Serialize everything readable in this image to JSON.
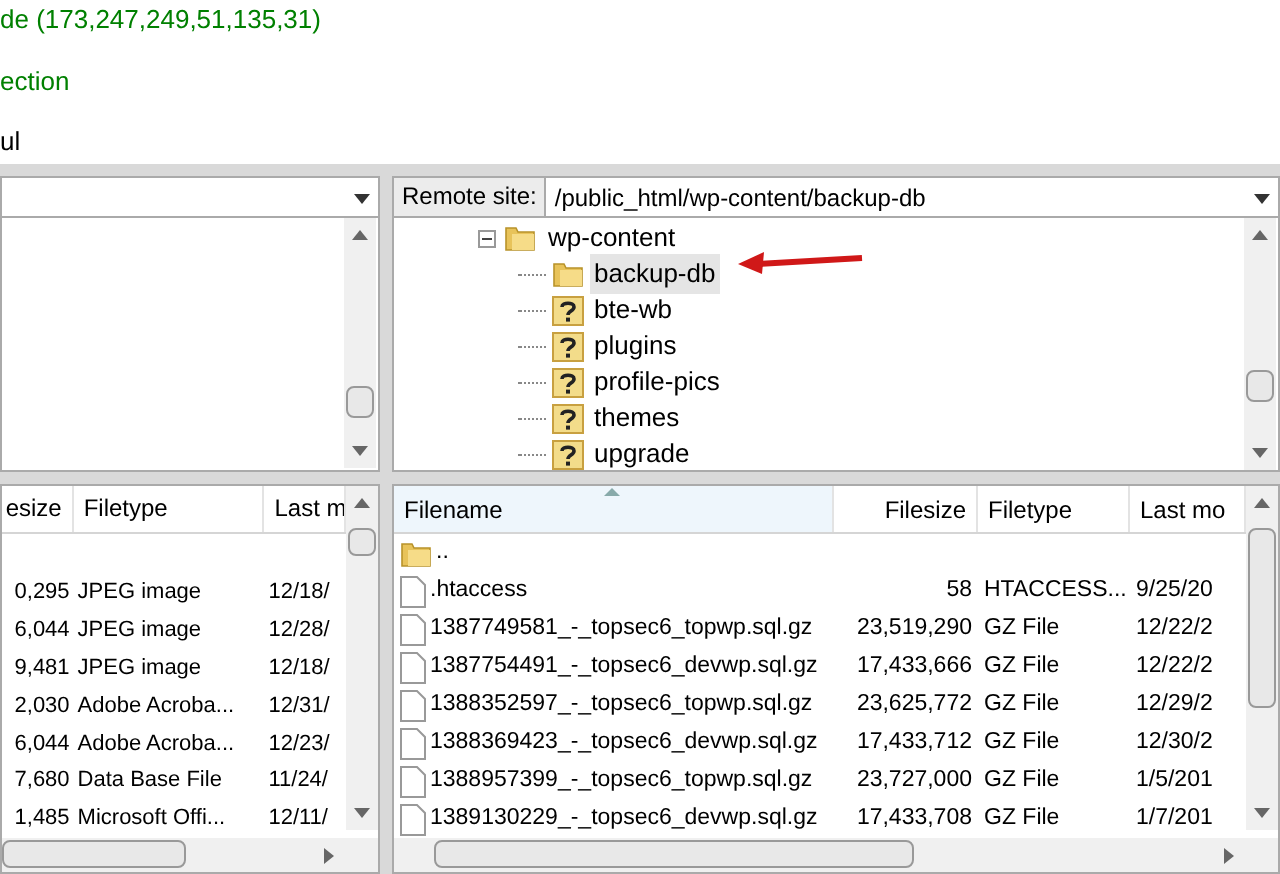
{
  "log": [
    {
      "text": "de (173,247,249,51,135,31)",
      "kind": "status"
    },
    {
      "text": "ection",
      "kind": "status"
    },
    {
      "text": "ul",
      "kind": "response"
    }
  ],
  "remote_site": {
    "label": "Remote site:",
    "path": "/public_html/wp-content/backup-db"
  },
  "remote_tree": [
    {
      "label": "wp-content",
      "expanded": true,
      "selected": false,
      "kind": "folder",
      "children": [
        {
          "label": "backup-db",
          "selected": true,
          "kind": "folder"
        },
        {
          "label": "bte-wb",
          "selected": false,
          "kind": "unknown"
        },
        {
          "label": "plugins",
          "selected": false,
          "kind": "unknown"
        },
        {
          "label": "profile-pics",
          "selected": false,
          "kind": "unknown"
        },
        {
          "label": "themes",
          "selected": false,
          "kind": "unknown"
        },
        {
          "label": "upgrade",
          "selected": false,
          "kind": "unknown"
        }
      ]
    }
  ],
  "local_files": {
    "columns": [
      {
        "label": "esize",
        "sorted": false
      },
      {
        "label": "Filetype",
        "sorted": false
      },
      {
        "label": "Last m",
        "sorted": false
      }
    ],
    "rows": [
      [
        "0,295",
        "JPEG image",
        "12/18/"
      ],
      [
        "6,044",
        "JPEG image",
        "12/28/"
      ],
      [
        "9,481",
        "JPEG image",
        "12/18/"
      ],
      [
        "2,030",
        "Adobe Acroba...",
        "12/31/"
      ],
      [
        "6,044",
        "Adobe Acroba...",
        "12/23/"
      ],
      [
        "7,680",
        "Data Base File",
        "11/24/"
      ],
      [
        "1,485",
        "Microsoft Offi...",
        "12/11/"
      ]
    ]
  },
  "remote_files": {
    "columns": [
      {
        "label": "Filename",
        "sorted": true
      },
      {
        "label": "Filesize",
        "sorted": false
      },
      {
        "label": "Filetype",
        "sorted": false
      },
      {
        "label": "Last mo",
        "sorted": false
      }
    ],
    "rows": [
      {
        "kind": "folder",
        "cells": [
          "..",
          "",
          "",
          ""
        ]
      },
      {
        "kind": "file",
        "cells": [
          ".htaccess",
          "58",
          "HTACCESS...",
          "9/25/20"
        ]
      },
      {
        "kind": "file",
        "cells": [
          "1387749581_-_topsec6_topwp.sql.gz",
          "23,519,290",
          "GZ File",
          "12/22/2"
        ]
      },
      {
        "kind": "file",
        "cells": [
          "1387754491_-_topsec6_devwp.sql.gz",
          "17,433,666",
          "GZ File",
          "12/22/2"
        ]
      },
      {
        "kind": "file",
        "cells": [
          "1388352597_-_topsec6_topwp.sql.gz",
          "23,625,772",
          "GZ File",
          "12/29/2"
        ]
      },
      {
        "kind": "file",
        "cells": [
          "1388369423_-_topsec6_devwp.sql.gz",
          "17,433,712",
          "GZ File",
          "12/30/2"
        ]
      },
      {
        "kind": "file",
        "cells": [
          "1388957399_-_topsec6_topwp.sql.gz",
          "23,727,000",
          "GZ File",
          "1/5/201"
        ]
      },
      {
        "kind": "file",
        "cells": [
          "1389130229_-_topsec6_devwp.sql.gz",
          "17,433,708",
          "GZ File",
          "1/7/201"
        ]
      }
    ]
  }
}
